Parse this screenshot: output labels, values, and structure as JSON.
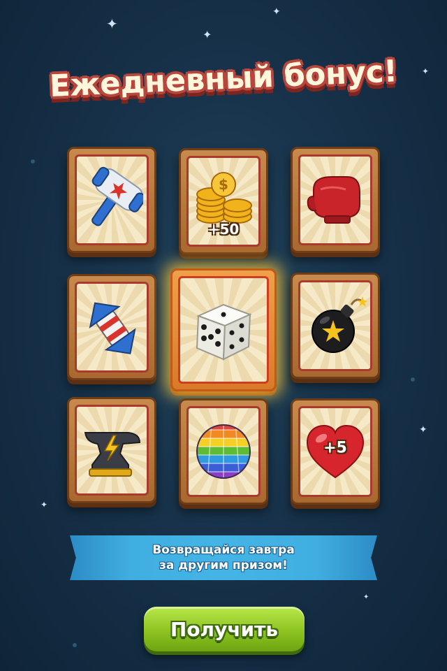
{
  "title": "Ежедневный бонус!",
  "rewards": [
    {
      "name": "hammer",
      "label": ""
    },
    {
      "name": "coins",
      "label": "+50"
    },
    {
      "name": "boxing-glove",
      "label": ""
    },
    {
      "name": "swap",
      "label": ""
    },
    {
      "name": "dice",
      "label": "",
      "selected": true
    },
    {
      "name": "bomb",
      "label": ""
    },
    {
      "name": "anvil",
      "label": ""
    },
    {
      "name": "rainbow-ball",
      "label": ""
    },
    {
      "name": "heart",
      "label": "+5"
    }
  ],
  "banner": {
    "line1": "Возвращайся завтра",
    "line2": "за другим призом!"
  },
  "button": {
    "label": "Получить"
  },
  "colors": {
    "background": "#17324a",
    "title_outline": "#b8463c",
    "banner": "#44b4e6",
    "button": "#8dc421",
    "glow": "#ffc83c"
  }
}
